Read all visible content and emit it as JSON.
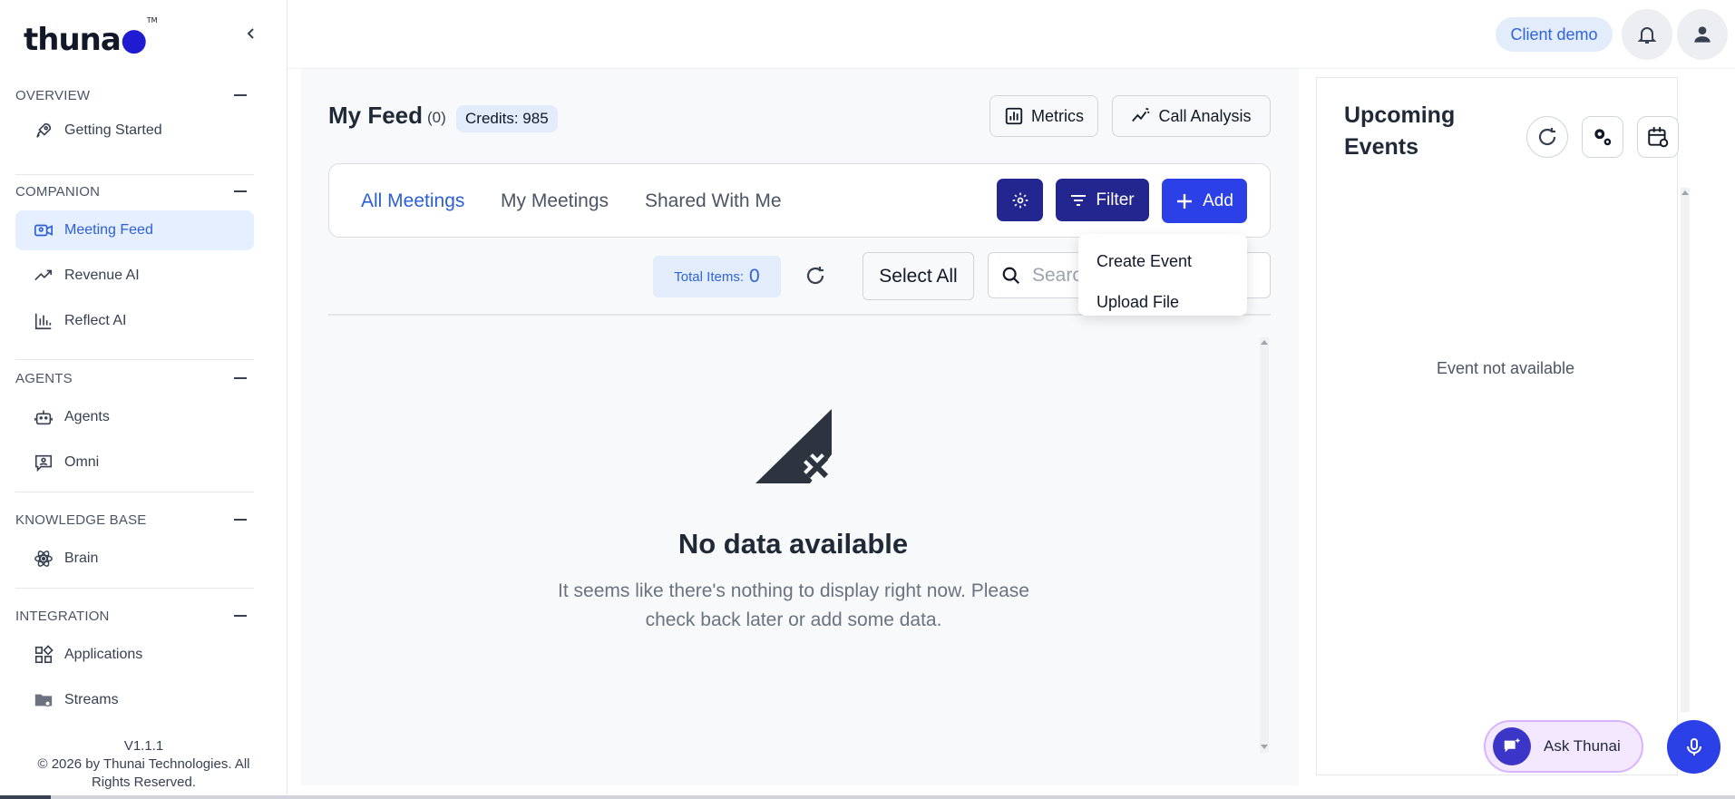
{
  "brand": {
    "logo_text": "thuna",
    "logo_suffix": "●",
    "trademark": "TM"
  },
  "sidebar": {
    "sections": [
      {
        "title": "OVERVIEW",
        "items": [
          {
            "label": "Getting Started",
            "icon": "rocket-icon"
          }
        ]
      },
      {
        "title": "COMPANION",
        "items": [
          {
            "label": "Meeting Feed",
            "icon": "video-feed-icon",
            "active": true
          },
          {
            "label": "Revenue AI",
            "icon": "trend-up-icon"
          },
          {
            "label": "Reflect AI",
            "icon": "bar-chart-icon"
          }
        ]
      },
      {
        "title": "AGENTS",
        "items": [
          {
            "label": "Agents",
            "icon": "robot-icon"
          },
          {
            "label": "Omni",
            "icon": "user-chat-icon"
          }
        ]
      },
      {
        "title": "KNOWLEDGE BASE",
        "items": [
          {
            "label": "Brain",
            "icon": "atom-icon"
          }
        ]
      },
      {
        "title": "INTEGRATION",
        "items": [
          {
            "label": "Applications",
            "icon": "apps-grid-icon"
          },
          {
            "label": "Streams",
            "icon": "folder-gear-icon"
          }
        ]
      }
    ],
    "version": "V1.1.1",
    "copyright": "© 2026 by Thunai Technologies. All Rights Reserved."
  },
  "topbar": {
    "client_label": "Client demo"
  },
  "feed": {
    "title": "My Feed",
    "count": "(0)",
    "credits": "Credits: 985",
    "metrics_label": "Metrics",
    "call_analysis_label": "Call Analysis",
    "tabs": [
      "All Meetings",
      "My Meetings",
      "Shared With Me"
    ],
    "filter_label": "Filter",
    "add_label": "Add",
    "add_menu": [
      "Create Event",
      "Upload File"
    ],
    "total_items_label": "Total Items:",
    "total_items_value": "0",
    "select_all_label": "Select All",
    "search_placeholder": "Search",
    "empty_title": "No data available",
    "empty_desc": "It seems like there's nothing to display right now. Please check back later or add some data."
  },
  "events": {
    "title": "Upcoming Events",
    "empty_text": "Event not available"
  },
  "assistant": {
    "ask_label": "Ask Thunai"
  },
  "colors": {
    "accent": "#2b40e6",
    "dark_accent": "#23268f",
    "link_blue": "#2b5fd9",
    "active_bg": "#e6efff"
  }
}
